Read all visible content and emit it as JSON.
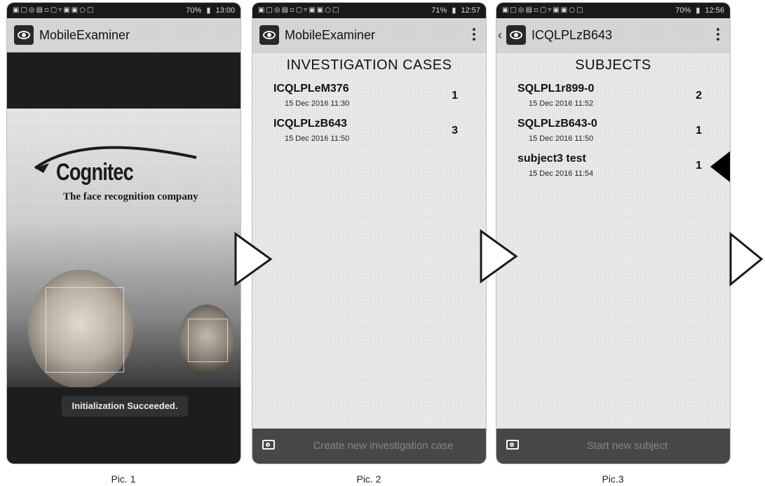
{
  "status_bars": [
    {
      "icons": "▣□◎▤▫▢▿▣▣○□",
      "battery": "70%",
      "time": "13:00"
    },
    {
      "icons": "▣□◎▤▫▢▿▣▣○□",
      "battery": "71%",
      "time": "12:57"
    },
    {
      "icons": "▣□◎▤▫▢▿▣▣○□",
      "battery": "70%",
      "time": "12:56"
    }
  ],
  "pic1": {
    "app_title": "MobileExaminer",
    "logo_text": "Cognitec",
    "tagline": "The face recognition company",
    "status_message": "Initialization Succeeded.",
    "caption": "Pic. 1"
  },
  "pic2": {
    "app_title": "MobileExaminer",
    "header": "INVESTIGATION CASES",
    "items": [
      {
        "title": "ICQLPLeM376",
        "date": "15 Dec 2016 11:30",
        "count": "1"
      },
      {
        "title": "ICQLPLzB643",
        "date": "15 Dec 2016 11:50",
        "count": "3"
      }
    ],
    "bottom_label": "Create new investigation case",
    "caption": "Pic. 2"
  },
  "pic3": {
    "app_title": "ICQLPLzB643",
    "header": "SUBJECTS",
    "items": [
      {
        "title": "SQLPL1r899-0",
        "date": "15 Dec 2016 11:52",
        "count": "2"
      },
      {
        "title": "SQLPLzB643-0",
        "date": "15 Dec 2016 11:50",
        "count": "1"
      },
      {
        "title": "subject3 test",
        "date": "15 Dec 2016 11:54",
        "count": "1"
      }
    ],
    "bottom_label": "Start new subject",
    "caption": "Pic.3"
  },
  "icons": {
    "app_icon": "eye-icon",
    "camera": "camera-icon",
    "overflow": "overflow-menu-icon",
    "back": "back-chevron-icon",
    "flow_arrow": "right-arrow-outline-icon"
  },
  "colors": {
    "status_bar": "#1a1a1a",
    "app_bar": "#dcdcdc",
    "screen_bg": "#eeeeee",
    "bottom_bar": "#4a4a4a",
    "splash_bg": "#1e1e1e"
  }
}
